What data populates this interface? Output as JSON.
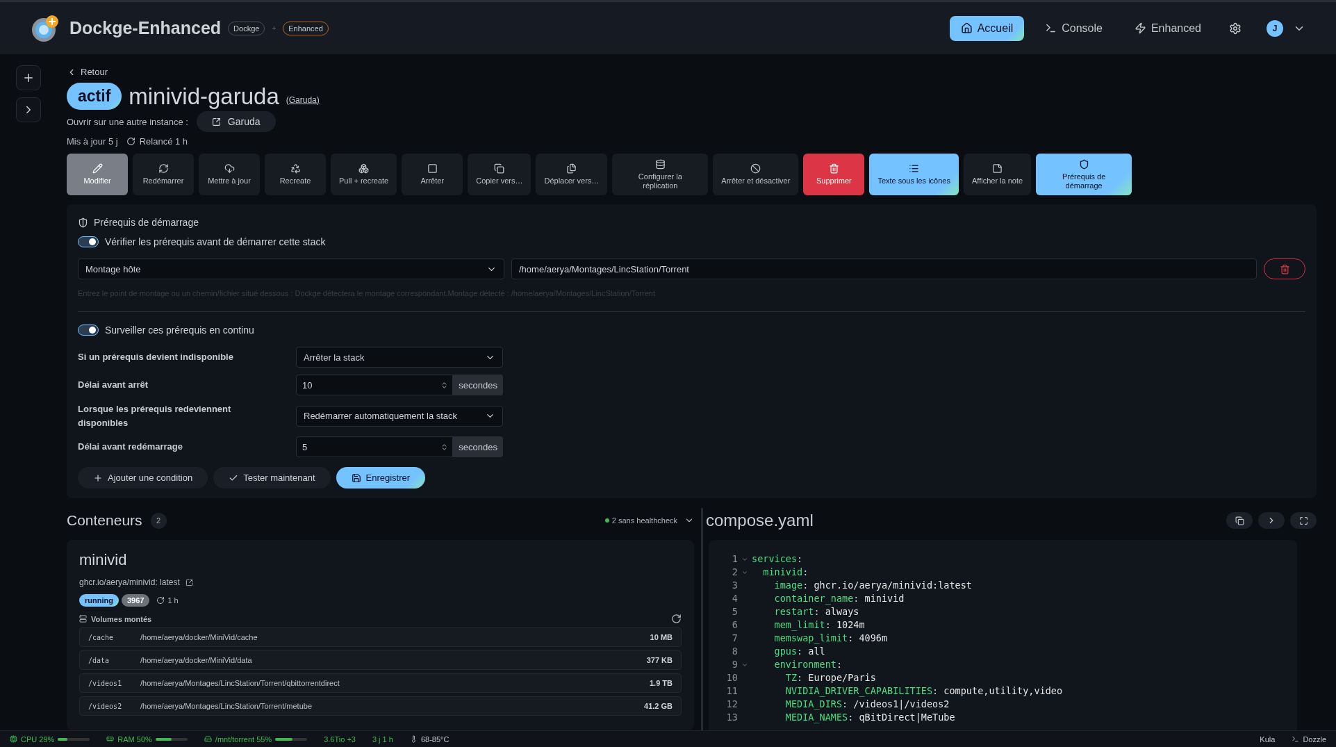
{
  "header": {
    "title": "Dockge-Enhanced",
    "badges": [
      {
        "label": "Dockge",
        "color": "#4a4f58"
      },
      {
        "label": "Enhanced",
        "color": "#b8651b"
      }
    ],
    "joiner": "+",
    "nav": [
      {
        "label": "Accueil",
        "selected": true
      },
      {
        "label": "Console",
        "selected": false
      },
      {
        "label": "Enhanced",
        "selected": false
      }
    ],
    "avatar": "J"
  },
  "stack": {
    "back": "Retour",
    "status": "actif",
    "name": "minivid-garuda",
    "host": "(Garuda)",
    "open_label": "Ouvrir sur une autre instance :",
    "open_button": "Garuda",
    "updated": "Mis à jour 5 j",
    "restarted": "Relancé 1 h"
  },
  "toolbar": [
    {
      "label": "Modifier",
      "kind": "active"
    },
    {
      "label": "Redémarrer",
      "kind": "plain"
    },
    {
      "label": "Mettre à jour",
      "kind": "plain"
    },
    {
      "label": "Recreate",
      "kind": "plain"
    },
    {
      "label": "Pull + recreate",
      "kind": "plain"
    },
    {
      "label": "Arrêter",
      "kind": "plain"
    },
    {
      "label": "Copier vers…",
      "kind": "plain"
    },
    {
      "label": "Déplacer vers…",
      "kind": "plain"
    },
    {
      "label": "Configurer la réplication",
      "kind": "plain"
    },
    {
      "label": "Arrêter et désactiver",
      "kind": "plain"
    },
    {
      "label": "Supprimer",
      "kind": "danger"
    },
    {
      "label": "Texte sous les icônes",
      "kind": "accent"
    },
    {
      "label": "Afficher la note",
      "kind": "plain"
    },
    {
      "label": "Prérequis de démarrage",
      "kind": "accent"
    }
  ],
  "prereq": {
    "title": "Prérequis de démarrage",
    "verify": {
      "label": "Vérifier les prérequis avant de démarrer cette stack",
      "on": true
    },
    "condition": {
      "type": "Montage hôte",
      "path": "/home/aerya/Montages/LincStation/Torrent",
      "hint": "Entrez le point de montage ou un chemin/fichier situé dessous : Dockge détectera le montage correspondant.Montage détecté : /home/aerya/Montages/LincStation/Torrent"
    },
    "monitor": {
      "label": "Surveiller ces prérequis en continu",
      "on": true
    },
    "settings": [
      {
        "label": "Si un prérequis devient indisponible",
        "kind": "select",
        "value": "Arrêter la stack"
      },
      {
        "label": "Délai avant arrêt",
        "kind": "number",
        "value": "10",
        "unit": "secondes"
      },
      {
        "label": "Lorsque les prérequis redeviennent disponibles",
        "kind": "select",
        "value": "Redémarrer automatiquement la stack"
      },
      {
        "label": "Délai avant redémarrage",
        "kind": "number",
        "value": "5",
        "unit": "secondes"
      }
    ],
    "actions": [
      {
        "label": "Ajouter une condition",
        "kind": "plain"
      },
      {
        "label": "Tester maintenant",
        "kind": "plain"
      },
      {
        "label": "Enregistrer",
        "kind": "primary"
      }
    ]
  },
  "containers": {
    "title": "Conteneurs",
    "count": "2",
    "health": "2 sans healthcheck",
    "card": {
      "name": "minivid",
      "image": "ghcr.io/aerya/minivid: latest",
      "state": "running",
      "pid": "3967",
      "uptime": "1 h",
      "volumes_title": "Volumes montés",
      "volumes": [
        {
          "mount": "/cache",
          "source": "/home/aerya/docker/MiniVid/cache",
          "size": "10 MB"
        },
        {
          "mount": "/data",
          "source": "/home/aerya/docker/MiniVid/data",
          "size": "377 KB"
        },
        {
          "mount": "/videos1",
          "source": "/home/aerya/Montages/LincStation/Torrent/qbittorrentdirect",
          "size": "1.9 TB"
        },
        {
          "mount": "/videos2",
          "source": "/home/aerya/Montages/LincStation/Torrent/metube",
          "size": "41.2 GB"
        }
      ]
    }
  },
  "compose": {
    "title": "compose.yaml",
    "lines": [
      {
        "n": "1",
        "fold": true,
        "key": "services",
        "sep": ":"
      },
      {
        "n": "2",
        "fold": true,
        "key": "  minivid",
        "sep": ":"
      },
      {
        "n": "3",
        "fold": false,
        "key": "    image",
        "sep": ":",
        "value": " ghcr.io/aerya/minivid:latest"
      },
      {
        "n": "4",
        "fold": false,
        "key": "    container_name",
        "sep": ":",
        "value": " minivid"
      },
      {
        "n": "5",
        "fold": false,
        "key": "    restart",
        "sep": ":",
        "value": " always"
      },
      {
        "n": "6",
        "fold": false,
        "key": "    mem_limit",
        "sep": ":",
        "value": " 1024m"
      },
      {
        "n": "7",
        "fold": false,
        "key": "    memswap_limit",
        "sep": ":",
        "value": " 4096m"
      },
      {
        "n": "8",
        "fold": false,
        "key": "    gpus",
        "sep": ":",
        "value": " all"
      },
      {
        "n": "9",
        "fold": true,
        "key": "    environment",
        "sep": ":"
      },
      {
        "n": "10",
        "fold": false,
        "key": "      TZ",
        "sep": ":",
        "value": " Europe/Paris"
      },
      {
        "n": "11",
        "fold": false,
        "key": "      NVIDIA_DRIVER_CAPABILITIES",
        "sep": ":",
        "value": " compute,utility,video"
      },
      {
        "n": "12",
        "fold": false,
        "key": "      MEDIA_DIRS",
        "sep": ":",
        "value": " /videos1|/videos2"
      },
      {
        "n": "13",
        "fold": false,
        "key": "      MEDIA_NAMES",
        "sep": ":",
        "value": " qBitDirect|MeTube"
      }
    ]
  },
  "status_bar": {
    "left": [
      {
        "kind": "meter",
        "label": "CPU 29%",
        "level": 0.29
      },
      {
        "kind": "meter",
        "label": "RAM 50%",
        "level": 0.5
      },
      {
        "kind": "meter",
        "label": "/mnt/torrent 55%",
        "level": 0.55
      },
      {
        "kind": "text",
        "label": "3.6Tio +3"
      },
      {
        "kind": "text",
        "label": "3 j 1 h"
      },
      {
        "kind": "temp",
        "label": "68-85°C"
      }
    ],
    "right": [
      "Kula",
      "Dozzle"
    ]
  }
}
